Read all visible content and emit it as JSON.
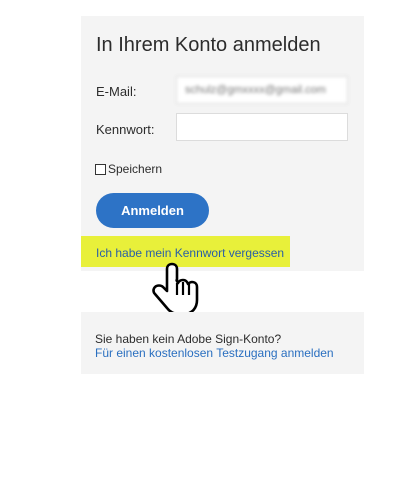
{
  "login": {
    "title": "In Ihrem Konto anmelden",
    "email_label": "E-Mail:",
    "email_value": "schulz@gmxxxx@gmail.com",
    "password_label": "Kennwort:",
    "password_value": "",
    "remember_label": "Speichern",
    "remember_checked": false,
    "signin_label": "Anmelden",
    "forgot_link": "Ich habe mein Kennwort vergessen"
  },
  "signup": {
    "question": "Sie haben kein Adobe Sign-Konto?",
    "link": "Für einen kostenlosen Testzugang anmelden"
  },
  "colors": {
    "card_background": "#f4f4f4",
    "primary_button": "#2d73c6",
    "highlight": "#e8f03a",
    "link": "#2a6fc0"
  },
  "cursor": {
    "icon": "hand-pointer-icon"
  }
}
